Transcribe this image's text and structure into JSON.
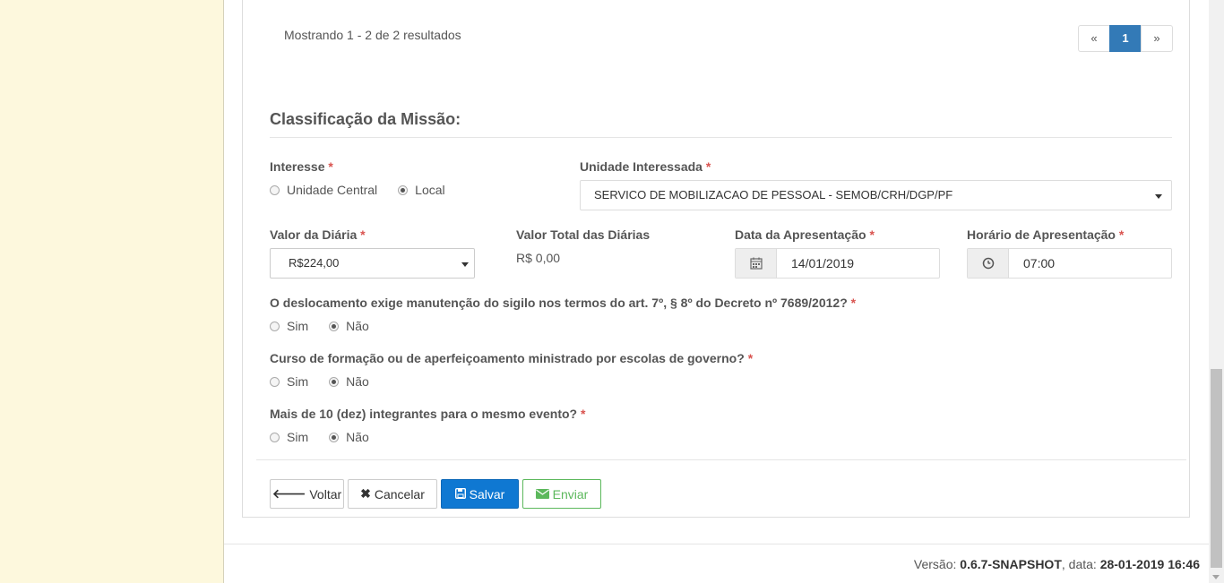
{
  "pagination": {
    "summary": "Mostrando 1 - 2 de 2 resultados",
    "prev": "«",
    "current": "1",
    "next": "»"
  },
  "section": {
    "title": "Classificação da Missão:"
  },
  "interesse": {
    "label": "Interesse",
    "required": "*",
    "options": [
      "Unidade Central",
      "Local"
    ],
    "selected": "Local"
  },
  "unidade": {
    "label": "Unidade Interessada",
    "required": "*",
    "value": "SERVICO DE MOBILIZACAO DE PESSOAL - SEMOB/CRH/DGP/PF"
  },
  "valor_diaria": {
    "label": "Valor da Diária",
    "required": "*",
    "value": "R$224,00"
  },
  "valor_total": {
    "label": "Valor Total das Diárias",
    "value": "R$ 0,00"
  },
  "data_apresentacao": {
    "label": "Data da Apresentação",
    "required": "*",
    "value": "14/01/2019",
    "icon": "calendar-icon"
  },
  "horario_apresentacao": {
    "label": "Horário de Apresentação",
    "required": "*",
    "value": "07:00",
    "icon": "clock-icon"
  },
  "q_sigilo": {
    "label": "O deslocamento exige manutenção do sigilo nos termos do art. 7º, § 8º do Decreto nº 7689/2012?",
    "required": "*",
    "options": [
      "Sim",
      "Não"
    ],
    "selected": "Não"
  },
  "q_curso": {
    "label": "Curso de formação ou de aperfeiçoamento ministrado por escolas de governo?",
    "required": "*",
    "options": [
      "Sim",
      "Não"
    ],
    "selected": "Não"
  },
  "q_integrantes": {
    "label": "Mais de 10 (dez) integrantes para o mesmo evento?",
    "required": "*",
    "options": [
      "Sim",
      "Não"
    ],
    "selected": "Não"
  },
  "buttons": {
    "voltar": "Voltar",
    "cancelar": "Cancelar",
    "salvar": "Salvar",
    "enviar": "Enviar"
  },
  "footer": {
    "version_label": "Versão:",
    "version": "0.6.7-SNAPSHOT",
    "date_label": ", data:",
    "date": "28-01-2019 16:46"
  },
  "colors": {
    "primary": "#0f78d2",
    "success": "#5cb85c",
    "sidebar_bg": "#fdf8dd",
    "required": "#d9534f"
  }
}
